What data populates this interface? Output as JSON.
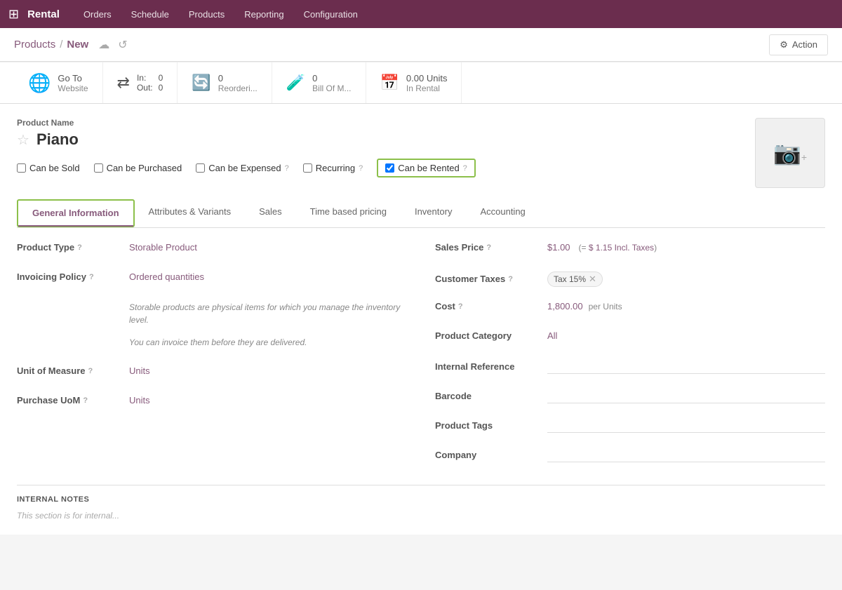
{
  "app": {
    "name": "Rental",
    "grid_icon": "⊞"
  },
  "nav": {
    "items": [
      "Orders",
      "Schedule",
      "Products",
      "Reporting",
      "Configuration"
    ]
  },
  "breadcrumb": {
    "parent": "Products",
    "current": "New",
    "separator": "/",
    "action_label": "Action",
    "action_icon": "⚙"
  },
  "smart_buttons": [
    {
      "id": "go-to-website",
      "icon": "globe",
      "label": "Go To",
      "sublabel": "Website"
    },
    {
      "id": "in-out",
      "icon": "arrows",
      "in_label": "In:",
      "in_value": "0",
      "out_label": "Out:",
      "out_value": "0"
    },
    {
      "id": "reordering",
      "icon": "refresh",
      "value": "0",
      "label": "Reorderi..."
    },
    {
      "id": "bill-of-materials",
      "icon": "flask",
      "value": "0",
      "label": "Bill Of M..."
    },
    {
      "id": "units-in-rental",
      "icon": "calendar",
      "value": "0.00 Units",
      "label": "In Rental"
    }
  ],
  "product": {
    "name_label": "Product Name",
    "name": "Piano",
    "star": "☆",
    "checkboxes": {
      "can_be_sold": "Can be Sold",
      "can_be_purchased": "Can be Purchased",
      "can_be_expensed": "Can be Expensed",
      "recurring": "Recurring",
      "can_be_rented": "Can be Rented"
    },
    "checkbox_states": {
      "can_be_sold": false,
      "can_be_purchased": false,
      "can_be_expensed": false,
      "recurring": false,
      "can_be_rented": true
    }
  },
  "tabs": [
    {
      "id": "general-information",
      "label": "General Information",
      "active": true
    },
    {
      "id": "attributes-variants",
      "label": "Attributes & Variants",
      "active": false
    },
    {
      "id": "sales",
      "label": "Sales",
      "active": false
    },
    {
      "id": "time-based-pricing",
      "label": "Time based pricing",
      "active": false
    },
    {
      "id": "inventory",
      "label": "Inventory",
      "active": false
    },
    {
      "id": "accounting",
      "label": "Accounting",
      "active": false
    }
  ],
  "general_info": {
    "left": {
      "product_type_label": "Product Type",
      "product_type_value": "Storable Product",
      "invoicing_policy_label": "Invoicing Policy",
      "invoicing_policy_value": "Ordered quantities",
      "hint1": "Storable products are physical items for which you manage the inventory level.",
      "hint2": "You can invoice them before they are delivered.",
      "unit_of_measure_label": "Unit of Measure",
      "unit_of_measure_value": "Units",
      "purchase_uom_label": "Purchase UoM",
      "purchase_uom_value": "Units"
    },
    "right": {
      "sales_price_label": "Sales Price",
      "sales_price_value": "$1.00",
      "incl_taxes": "(= $ 1.15 Incl. Taxes)",
      "customer_taxes_label": "Customer Taxes",
      "tax_badge": "Tax 15%",
      "cost_label": "Cost",
      "cost_value": "1,800.00",
      "per_units": "per Units",
      "product_category_label": "Product Category",
      "product_category_value": "All",
      "internal_reference_label": "Internal Reference",
      "barcode_label": "Barcode",
      "product_tags_label": "Product Tags",
      "company_label": "Company"
    }
  },
  "internal_notes": {
    "title": "INTERNAL NOTES",
    "hint": "This section is for internal..."
  }
}
